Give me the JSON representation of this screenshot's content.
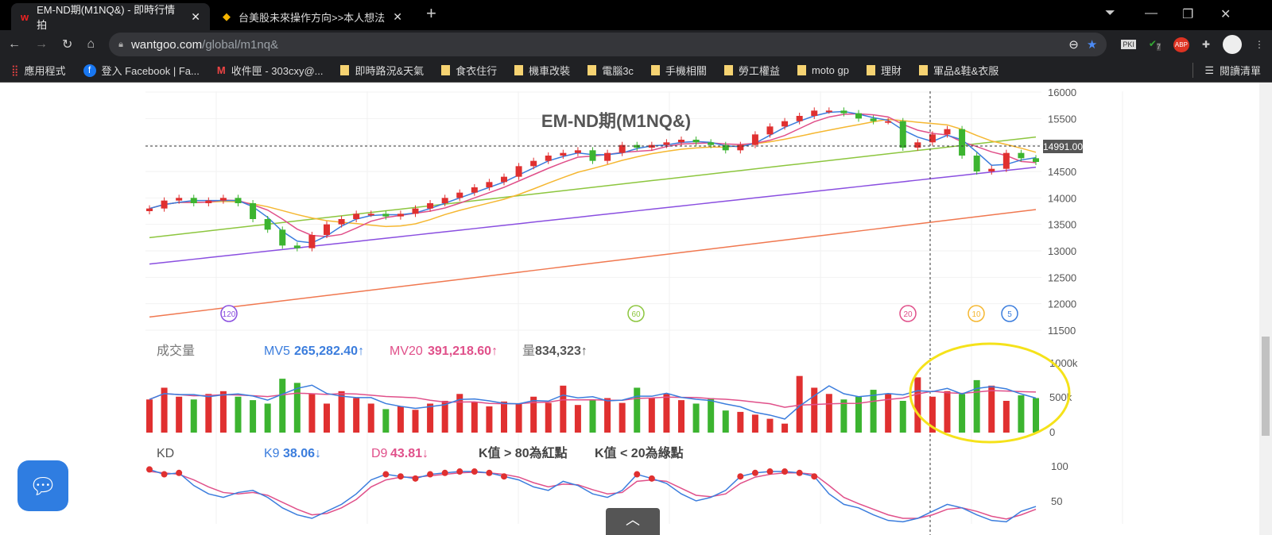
{
  "browser": {
    "tabs": [
      {
        "title": "EM-ND期(M1NQ&) - 即時行情拍",
        "active": true
      },
      {
        "title": "台美股未來操作方向>>本人想法",
        "active": false
      }
    ],
    "url_host": "wantgoo.com",
    "url_path": "/global/m1nq&",
    "extension_badge": "7",
    "abp_label": "ABP",
    "bookmarks": [
      "應用程式",
      "登入 Facebook | Fa...",
      "收件匣 - 303cxy@...",
      "即時路況&天氣",
      "食衣住行",
      "機車改裝",
      "電腦3c",
      "手機相關",
      "勞工權益",
      "moto gp",
      "理財",
      "軍品&鞋&衣服"
    ],
    "reading_list": "閱讀清單"
  },
  "chart": {
    "title": "EM-ND期(M1NQ&)",
    "current_price_label": "14991.00",
    "ma_markers": [
      "120",
      "60",
      "20",
      "10",
      "5"
    ],
    "volume": {
      "label": "成交量",
      "mv5_label": "MV5",
      "mv5_value": "265,282.40↑",
      "mv20_label": "MV20",
      "mv20_value": "391,218.60↑",
      "vol_label": "量",
      "vol_value": "834,323↑"
    },
    "kd": {
      "label": "KD",
      "k_label": "K9",
      "k_value": "38.06↓",
      "d_label": "D9",
      "d_value": "43.81↓",
      "note1": "K值 > 80為紅點",
      "note2": "K值 < 20為綠點"
    }
  },
  "chart_data": {
    "type": "candlestick",
    "title": "EM-ND期(M1NQ&)",
    "price_axis": {
      "ticks": [
        16000,
        15500,
        15000,
        14500,
        14000,
        13500,
        13000,
        12500,
        12000,
        11500
      ],
      "range": [
        11500,
        16000
      ]
    },
    "closes": [
      13800,
      13950,
      14000,
      13900,
      13950,
      14000,
      13900,
      13600,
      13400,
      13100,
      13050,
      13300,
      13500,
      13600,
      13700,
      13700,
      13650,
      13700,
      13800,
      13900,
      14000,
      14100,
      14200,
      14300,
      14400,
      14600,
      14700,
      14800,
      14850,
      14900,
      14700,
      14850,
      15000,
      14950,
      15000,
      15050,
      15100,
      15050,
      15000,
      14900,
      15000,
      15200,
      15350,
      15450,
      15550,
      15650,
      15650,
      15600,
      15500,
      15450,
      15450,
      14950,
      15050,
      15200,
      15300,
      14800,
      14500,
      14550,
      14850,
      14750,
      14680
    ],
    "ma60": [
      13250,
      15150
    ],
    "ma120": [
      12750,
      14580
    ],
    "ma240": [
      11750,
      13780
    ],
    "volume_axis": {
      "ticks": [
        "1000k",
        "500k",
        "0"
      ],
      "max": 1000
    },
    "volume_k": [
      480,
      650,
      520,
      480,
      560,
      600,
      520,
      470,
      420,
      780,
      720,
      560,
      420,
      600,
      500,
      420,
      340,
      380,
      330,
      420,
      460,
      560,
      440,
      380,
      450,
      420,
      520,
      430,
      680,
      400,
      480,
      500,
      430,
      650,
      500,
      560,
      470,
      420,
      500,
      320,
      300,
      260,
      200,
      130,
      820,
      650,
      560,
      480,
      520,
      620,
      560,
      460,
      800,
      520,
      600,
      560,
      760,
      680,
      460,
      540,
      500
    ],
    "kd_axis": {
      "ticks": [
        100,
        50
      ]
    },
    "k": [
      95,
      88,
      90,
      72,
      60,
      55,
      62,
      65,
      55,
      40,
      30,
      25,
      35,
      45,
      60,
      80,
      88,
      85,
      82,
      88,
      90,
      92,
      92,
      90,
      85,
      80,
      70,
      65,
      78,
      72,
      60,
      55,
      65,
      88,
      82,
      75,
      60,
      50,
      55,
      65,
      85,
      90,
      92,
      92,
      90,
      85,
      60,
      45,
      40,
      30,
      22,
      20,
      25,
      35,
      45,
      40,
      30,
      22,
      20,
      35,
      42
    ],
    "d": [
      92,
      90,
      88,
      80,
      70,
      62,
      60,
      62,
      58,
      48,
      38,
      30,
      32,
      40,
      52,
      70,
      80,
      84,
      84,
      86,
      88,
      90,
      91,
      90,
      88,
      84,
      76,
      70,
      74,
      73,
      66,
      60,
      62,
      78,
      80,
      78,
      68,
      58,
      56,
      60,
      75,
      84,
      88,
      90,
      90,
      88,
      72,
      55,
      46,
      38,
      30,
      25,
      25,
      30,
      38,
      40,
      35,
      28,
      24,
      30,
      38
    ]
  }
}
